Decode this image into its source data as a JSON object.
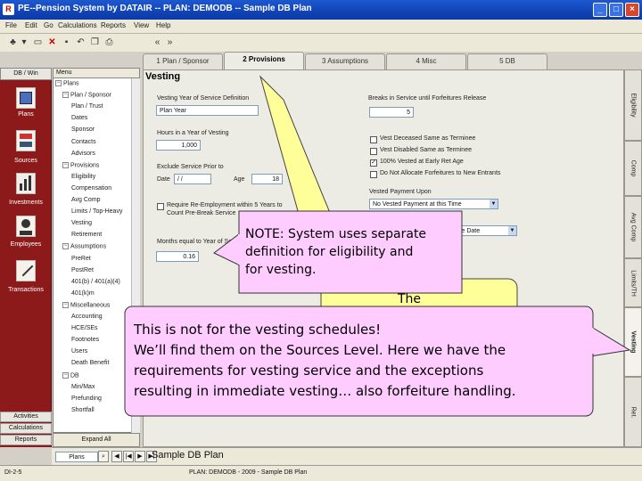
{
  "window": {
    "title": "PE--Pension System by DATAIR -- PLAN: DEMODB -- Sample DB Plan",
    "icon_text": "R"
  },
  "menu": [
    "File",
    "Edit",
    "Go",
    "Calculations",
    "Reports",
    "View",
    "Help"
  ],
  "toolbar": {
    "nav_back": "«",
    "nav_forward": "»"
  },
  "tabs": [
    {
      "label": "1 Plan / Sponsor"
    },
    {
      "label": "2 Provisions"
    },
    {
      "label": "3 Assumptions"
    },
    {
      "label": "4 Misc"
    },
    {
      "label": "5 DB"
    }
  ],
  "leftnav": {
    "header": "DB / Win",
    "items": [
      {
        "label": "Plans",
        "icon": "plans-book-icon"
      },
      {
        "label": "Sources",
        "icon": "sources-icon"
      },
      {
        "label": "Investments",
        "icon": "investments-chart-icon"
      },
      {
        "label": "Employees",
        "icon": "employees-icon"
      },
      {
        "label": "Transactions",
        "icon": "transactions-icon"
      }
    ],
    "bottom": [
      "Activities",
      "Calculations",
      "Reports"
    ]
  },
  "tree": {
    "header": "Menu",
    "items": [
      {
        "label": "Plans",
        "level": 0,
        "toggle": "−"
      },
      {
        "label": "Plan / Sponsor",
        "level": 1,
        "toggle": "−"
      },
      {
        "label": "Plan / Trust",
        "level": 2
      },
      {
        "label": "Dates",
        "level": 2
      },
      {
        "label": "Sponsor",
        "level": 2
      },
      {
        "label": "Contacts",
        "level": 2
      },
      {
        "label": "Advisors",
        "level": 2
      },
      {
        "label": "Provisions",
        "level": 1,
        "toggle": "−"
      },
      {
        "label": "Eligibility",
        "level": 2
      },
      {
        "label": "Compensation",
        "level": 2
      },
      {
        "label": "Avg Comp",
        "level": 2
      },
      {
        "label": "Limits / Top-Heavy",
        "level": 2
      },
      {
        "label": "Vesting",
        "level": 2
      },
      {
        "label": "Retirement",
        "level": 2
      },
      {
        "label": "Assumptions",
        "level": 1,
        "toggle": "−"
      },
      {
        "label": "PreRet",
        "level": 2
      },
      {
        "label": "PostRet",
        "level": 2
      },
      {
        "label": "401(b) / 401(a)(4)",
        "level": 2
      },
      {
        "label": "401(k)m",
        "level": 2
      },
      {
        "label": "Miscellaneous",
        "level": 1,
        "toggle": "−"
      },
      {
        "label": "Accounting",
        "level": 2
      },
      {
        "label": "HCE/SEs",
        "level": 2
      },
      {
        "label": "Footnotes",
        "level": 2
      },
      {
        "label": "Users",
        "level": 2
      },
      {
        "label": "Death Benefit",
        "level": 2
      },
      {
        "label": "DB",
        "level": 1,
        "toggle": "−"
      },
      {
        "label": "Min/Max",
        "level": 2
      },
      {
        "label": "Prefunding",
        "level": 2
      },
      {
        "label": "Shortfall",
        "level": 2
      }
    ],
    "expand_all": "Expand All"
  },
  "vesting": {
    "section_title": "Vesting",
    "year_def_label": "Vesting Year of Service Definition",
    "year_def_value": "Plan Year",
    "hours_label": "Hours in a Year of Vesting",
    "hours_value": "1,000",
    "exclude_label": "Exclude Service Prior to",
    "date_label": "Date",
    "date_value": "/ /",
    "age_label": "Age",
    "age_value": "18",
    "require_label_line1": "Require Re-Employment within 5 Years to",
    "require_label_line2": "Count Pre-Break Service",
    "months_label": "Months equal to Year of Service",
    "months_value": "0.16",
    "breaks_label": "Breaks in Service until Forfeitures Release",
    "breaks_value": "5",
    "checkboxes": [
      {
        "label": "Vest Deceased Same as Terminee",
        "checked": false
      },
      {
        "label": "Vest Disabled Same as Terminee",
        "checked": false
      },
      {
        "label": "100% Vested at Early Ret Age",
        "checked": true
      },
      {
        "label": "Do Not Allocate Forfeitures to New Entrants",
        "checked": false
      }
    ],
    "vested_payment_label": "Vested Payment Upon",
    "vested_payment_value": "No Vested Payment at this Time",
    "date_select_value": "se Date"
  },
  "right_tabs": [
    {
      "label": "Eligibility"
    },
    {
      "label": "Comp"
    },
    {
      "label": "Avg Comp"
    },
    {
      "label": "Limits/TH"
    },
    {
      "label": "Vesting"
    },
    {
      "label": "Ret."
    }
  ],
  "bottombar": {
    "record_label": "Plans",
    "plan_name": "Sample DB Plan"
  },
  "statusbar": {
    "left": "DI-2-5",
    "plan": "PLAN: DEMODB - 2009 - Sample DB Plan"
  },
  "callouts": {
    "note1_line1": "NOTE: System uses separate",
    "note1_line2": "definition for eligibility and",
    "note1_line3": "for vesting.",
    "yellow_text": "The",
    "note2_line1": "This is not for the vesting schedules!",
    "note2_line2": "We’ll find them on the Sources Level.  Here we have the",
    "note2_line3": "requirements for vesting service and the exceptions",
    "note2_line4": "resulting in immediate vesting… also forfeiture handling."
  },
  "colors": {
    "titlebar": "#1043b6",
    "leftnav": "#8c1a1a",
    "callout_pink": "#ffccff",
    "callout_yellow": "#ffff99"
  }
}
